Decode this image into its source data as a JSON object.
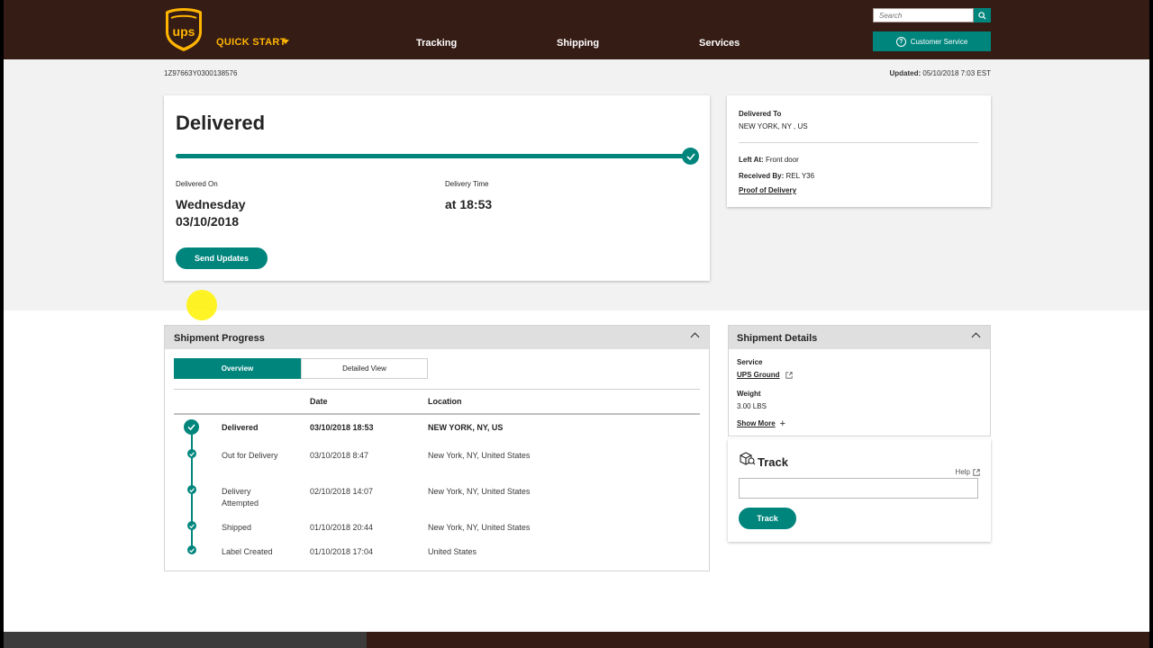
{
  "header": {
    "quick_start": "QUICK START",
    "nav": [
      "Tracking",
      "Shipping",
      "Services"
    ],
    "search_placeholder": "Search",
    "customer_service": "Customer Service"
  },
  "tracking_number": "1Z97663Y0300138576",
  "updated": {
    "label": "Updated:",
    "value": "05/10/2018 7:03 EST"
  },
  "status": {
    "title": "Delivered",
    "progress_fraction": 1.0,
    "delivered_on_label": "Delivered On",
    "delivered_on_day": "Wednesday",
    "delivered_on_date": "03/10/2018",
    "delivery_time_label": "Delivery Time",
    "delivery_time": "at 18:53",
    "send_updates": "Send Updates"
  },
  "destination": {
    "delivered_to_label": "Delivered To",
    "delivered_to_value": "NEW YORK, NY , US",
    "left_at_label": "Left At:",
    "left_at_value": "Front door",
    "received_by_label": "Received By:",
    "received_by_value": "REL Y36",
    "proof_link": "Proof of Delivery"
  },
  "shipment_progress": {
    "title": "Shipment Progress",
    "tabs": [
      "Overview",
      "Detailed View"
    ],
    "columns": [
      "Date",
      "Location"
    ],
    "rows": [
      {
        "activity": "Delivered",
        "date": "03/10/2018  18:53",
        "location": "NEW YORK, NY, US"
      },
      {
        "activity": "Out for Delivery",
        "date": "03/10/2018  8:47",
        "location": "New York, NY, United States"
      },
      {
        "activity": "Delivery Attempted",
        "date": "02/10/2018  14:07",
        "location": "New York, NY, United States"
      },
      {
        "activity": "Shipped",
        "date": "01/10/2018  20:44",
        "location": "New York, NY, United States"
      },
      {
        "activity": "Label Created",
        "date": "01/10/2018  17:04",
        "location": "United States"
      }
    ]
  },
  "shipment_details": {
    "title": "Shipment Details",
    "service_label": "Service",
    "service_value": "UPS Ground",
    "weight_label": "Weight",
    "weight_value": "3.00 LBS",
    "show_more": "Show More"
  },
  "track": {
    "title": "Track",
    "help": "Help",
    "button": "Track"
  },
  "colors": {
    "brand_brown": "#351c15",
    "accent_gold": "#ffb500",
    "teal": "#00857d"
  }
}
